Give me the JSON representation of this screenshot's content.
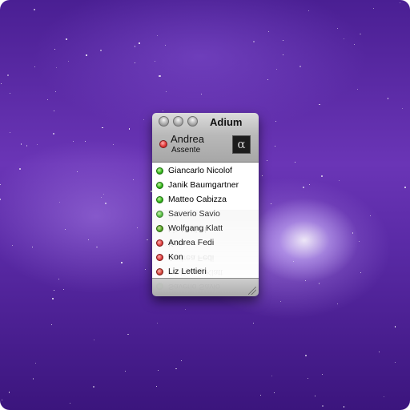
{
  "window": {
    "title": "Adium",
    "account": {
      "name": "Andrea",
      "status": "Assente",
      "avatar_icon": "alpha-icon"
    }
  },
  "contacts": [
    {
      "name": "Giancarlo Nicolof",
      "status": "online"
    },
    {
      "name": "Janik Baumgartner",
      "status": "online"
    },
    {
      "name": "Matteo Cabizza",
      "status": "online"
    },
    {
      "name": "Saverio Savio",
      "status": "online"
    },
    {
      "name": "Wolfgang Klatt",
      "status": "online"
    },
    {
      "name": "Andrea Fedi",
      "status": "offline"
    },
    {
      "name": "Kon",
      "status": "offline"
    },
    {
      "name": "Liz Lettieri",
      "status": "offline"
    }
  ],
  "colors": {
    "online": "#37b81e",
    "offline": "#e04040",
    "background": "#5a2aa6"
  }
}
